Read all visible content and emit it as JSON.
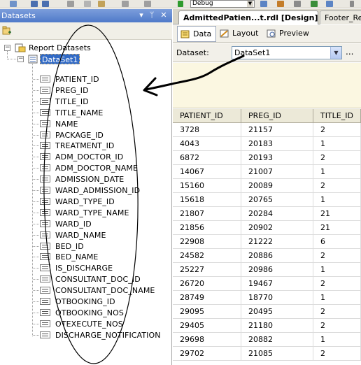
{
  "toolbar": {
    "config_value": "Debug"
  },
  "datasets_pane": {
    "title": "Datasets",
    "pin_glyph": "▾",
    "dock_glyph": "ᛘ",
    "close_glyph": "✕",
    "root_label": "Report Datasets",
    "dataset_label": "DataSet1",
    "fields": [
      "PATIENT_ID",
      "PREG_ID",
      "TITLE_ID",
      "TITLE_NAME",
      "NAME",
      "PACKAGE_ID",
      "TREATMENT_ID",
      "ADM_DOCTOR_ID",
      "ADM_DOCTOR_NAME",
      "ADMISSION_DATE",
      "WARD_ADMISSION_ID",
      "WARD_TYPE_ID",
      "WARD_TYPE_NAME",
      "WARD_ID",
      "WARD_NAME",
      "BED_ID",
      "BED_NAME",
      "IS_DISCHARGE",
      "CONSULTANT_DOC_ID",
      "CONSULTANT_DOC_NAME",
      "OTBOOKING_ID",
      "OTBOOKING_NOS",
      "OTEXECUTE_NOS",
      "DISCHARGE_NOTIFICATION"
    ]
  },
  "designer": {
    "doc_tabs": [
      "AdmittedPatien...t.rdl [Design]*",
      "Footer_Re"
    ],
    "sub_tabs": [
      "Data",
      "Layout",
      "Preview"
    ],
    "dataset_label": "Dataset:",
    "dataset_value": "DataSet1",
    "ellipsis": "...",
    "grid": {
      "headers": [
        "PATIENT_ID",
        "PREG_ID",
        "TITLE_ID"
      ],
      "rows": [
        [
          "3728",
          "21157",
          "2"
        ],
        [
          "4043",
          "20183",
          "1"
        ],
        [
          "6872",
          "20193",
          "2"
        ],
        [
          "14067",
          "21007",
          "1"
        ],
        [
          "15160",
          "20089",
          "2"
        ],
        [
          "15618",
          "20765",
          "1"
        ],
        [
          "21807",
          "20284",
          "21"
        ],
        [
          "21856",
          "20902",
          "21"
        ],
        [
          "22908",
          "21222",
          "6"
        ],
        [
          "24582",
          "20886",
          "2"
        ],
        [
          "25227",
          "20986",
          "1"
        ],
        [
          "26720",
          "19467",
          "2"
        ],
        [
          "28749",
          "18770",
          "1"
        ],
        [
          "29095",
          "20495",
          "2"
        ],
        [
          "29405",
          "21180",
          "2"
        ],
        [
          "29698",
          "20882",
          "1"
        ],
        [
          "29702",
          "21085",
          "2"
        ]
      ]
    }
  },
  "colors": {
    "title_bar": "#4f79c9",
    "query_area": "#fbf7e1",
    "grid_header": "#ece9d8"
  }
}
